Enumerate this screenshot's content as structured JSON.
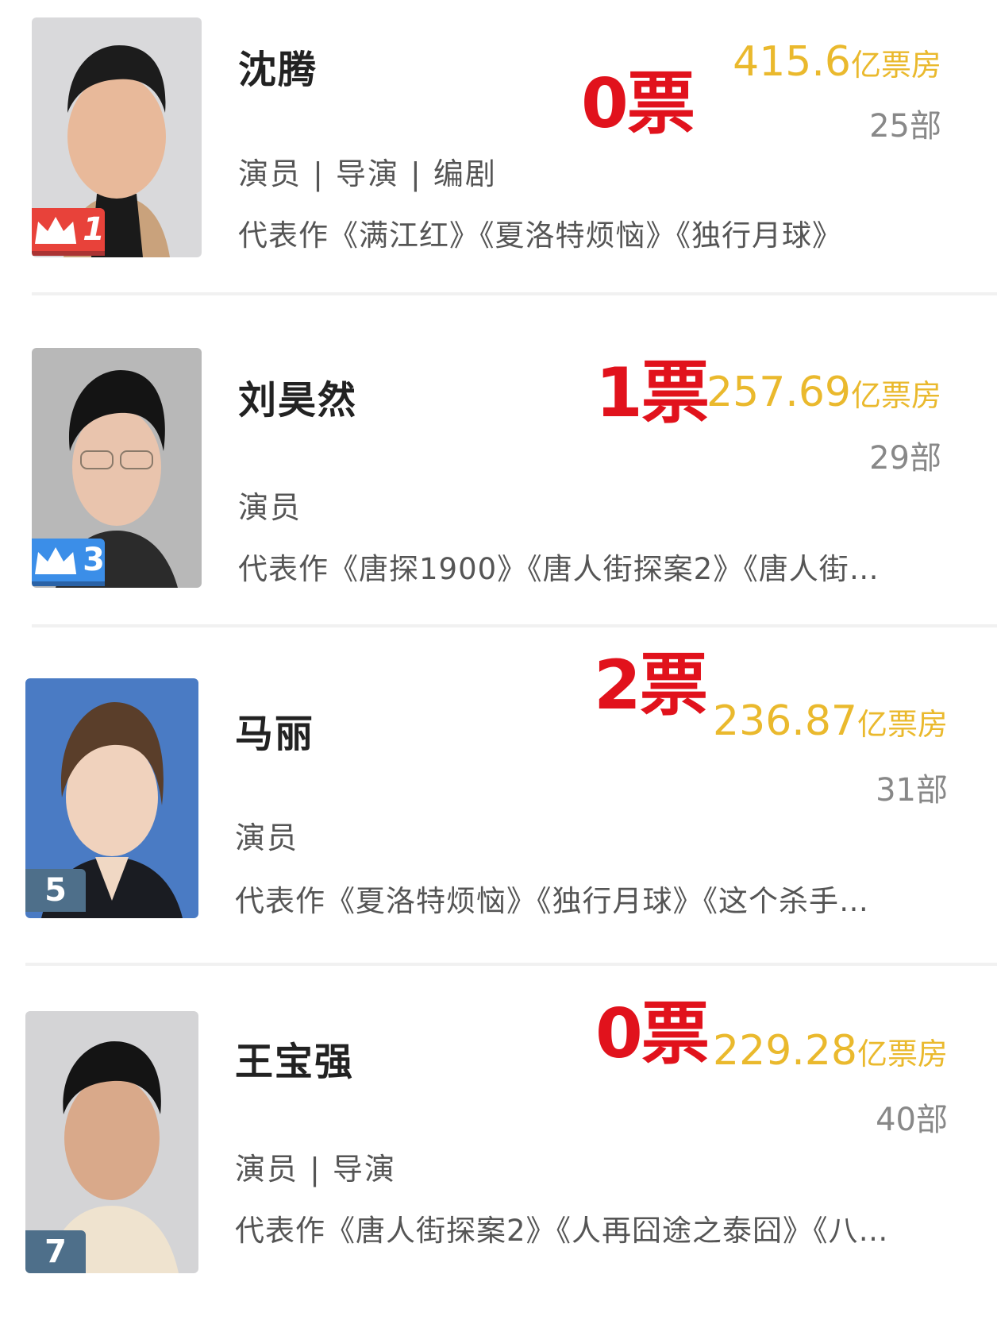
{
  "items": [
    {
      "name": "沈腾",
      "rank": "1",
      "roles": "演员 | 导演 | 编剧",
      "works": "代表作《满江红》《夏洛特烦恼》《独行月球》",
      "votes": "0票",
      "box_office_value": "415.6",
      "box_office_unit": "亿票房",
      "films_count": "25部"
    },
    {
      "name": "刘昊然",
      "rank": "3",
      "roles": "演员",
      "works": "代表作《唐探1900》《唐人街探案2》《唐人街…",
      "votes": "1票",
      "box_office_value": "257.69",
      "box_office_unit": "亿票房",
      "films_count": "29部"
    },
    {
      "name": "马丽",
      "rank": "5",
      "roles": "演员",
      "works": "代表作《夏洛特烦恼》《独行月球》《这个杀手…",
      "votes": "2票",
      "box_office_value": "236.87",
      "box_office_unit": "亿票房",
      "films_count": "31部"
    },
    {
      "name": "王宝强",
      "rank": "7",
      "roles": "演员 | 导演",
      "works": "代表作《唐人街探案2》《人再囧途之泰囧》《八…",
      "votes": "0票",
      "box_office_value": "229.28",
      "box_office_unit": "亿票房",
      "films_count": "40部"
    }
  ],
  "colors": {
    "votes": "#e1121c",
    "box_office": "#eab92d",
    "rank_gold": "#e8423a",
    "rank_blue": "#3b8ee8",
    "rank_gray": "#4e6f8a"
  }
}
